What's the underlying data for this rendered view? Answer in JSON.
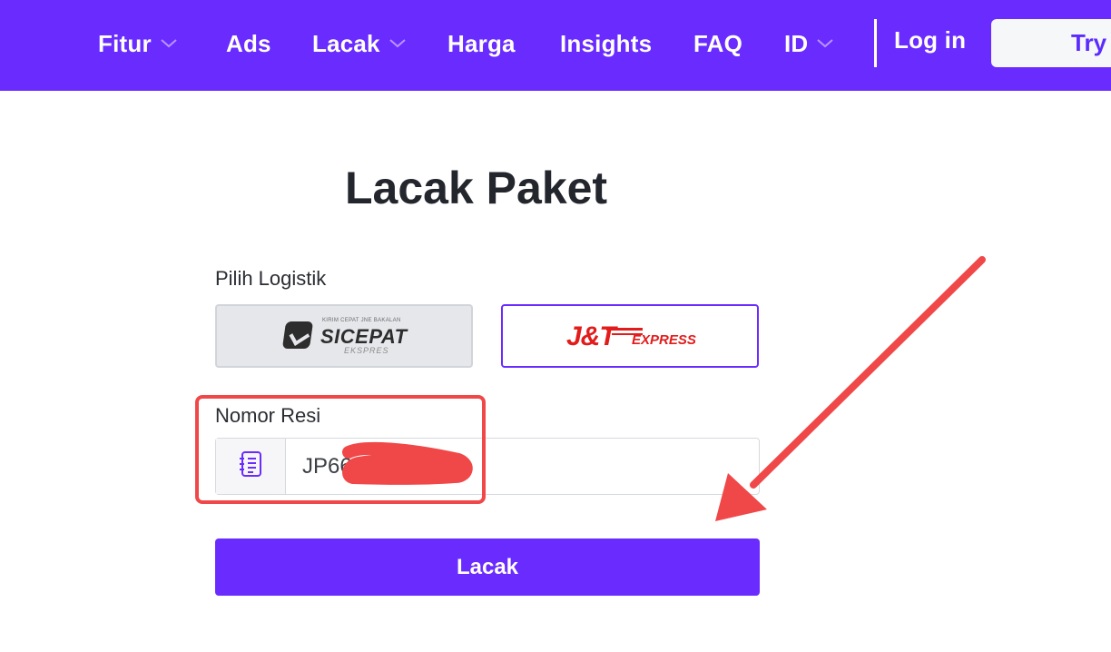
{
  "nav": {
    "items": [
      {
        "label": "Fitur",
        "has_dropdown": true
      },
      {
        "label": "Ads",
        "has_dropdown": false
      },
      {
        "label": "Lacak",
        "has_dropdown": true
      },
      {
        "label": "Harga",
        "has_dropdown": false
      },
      {
        "label": "Insights",
        "has_dropdown": false
      },
      {
        "label": "FAQ",
        "has_dropdown": false
      },
      {
        "label": "ID",
        "has_dropdown": true
      }
    ],
    "login_label": "Log in",
    "try_label": "Try"
  },
  "page": {
    "title": "Lacak Paket"
  },
  "logistics": {
    "label": "Pilih Logistik",
    "options": [
      {
        "name": "SiCepat Ekspres",
        "logo_text": "SICEPAT",
        "logo_tagline": "KIRIM CEPAT JNE BAKALAN",
        "logo_sub": "EKSPRES",
        "selected": false
      },
      {
        "name": "J&T Express",
        "logo_text": "J&T",
        "logo_sub": "EXPRESS",
        "selected": true
      }
    ]
  },
  "resi": {
    "label": "Nomor Resi",
    "value": "JP66",
    "icon": "notebook-icon"
  },
  "submit": {
    "label": "Lacak"
  },
  "colors": {
    "brand": "#6a2bff",
    "annotation": "#f04848",
    "jnt_red": "#e21b1b"
  }
}
